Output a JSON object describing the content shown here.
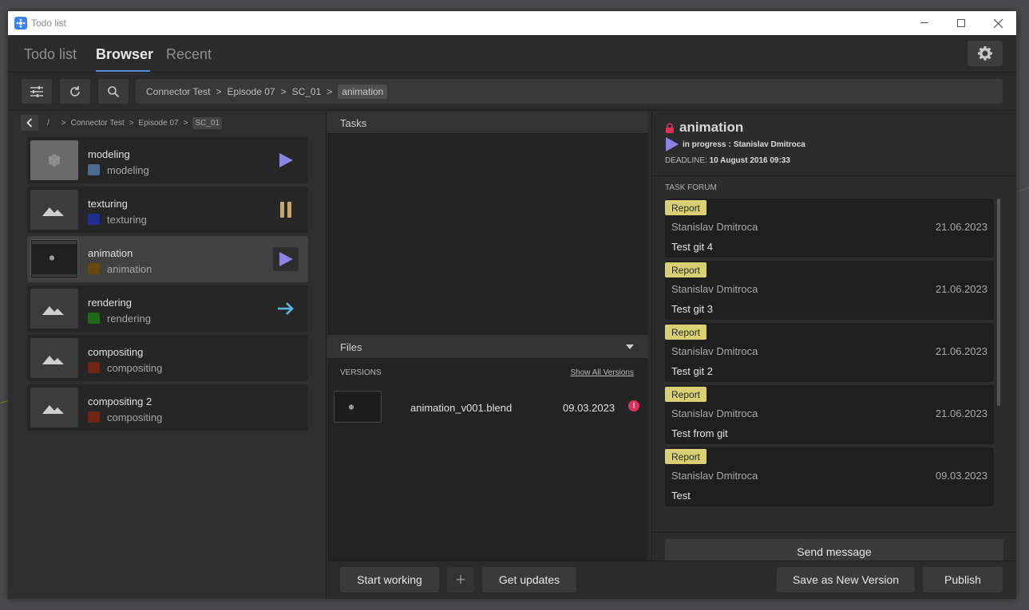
{
  "window": {
    "title": "Todo list"
  },
  "tabs": [
    {
      "label": "Todo list"
    },
    {
      "label": "Browser"
    },
    {
      "label": "Recent"
    }
  ],
  "toolbar": {
    "path": [
      "Connector Test",
      "Episode 07",
      "SC_01",
      "animation"
    ]
  },
  "breadcrumb": {
    "root": "/",
    "items": [
      "Connector Test",
      "Episode 07",
      "SC_01"
    ]
  },
  "tasks": [
    {
      "name": "modeling",
      "type": "modeling",
      "color": "#4d6a8f",
      "status": "play"
    },
    {
      "name": "texturing",
      "type": "texturing",
      "color": "#1f2f8f",
      "status": "pause"
    },
    {
      "name": "animation",
      "type": "animation",
      "color": "#6b4710",
      "status": "play"
    },
    {
      "name": "rendering",
      "type": "rendering",
      "color": "#1f6a16",
      "status": "arrow"
    },
    {
      "name": "compositing",
      "type": "compositing",
      "color": "#6e2412",
      "status": ""
    },
    {
      "name": "compositing 2",
      "type": "compositing",
      "color": "#6e2412",
      "status": ""
    }
  ],
  "middle": {
    "tasks_header": "Tasks",
    "files_header": "Files",
    "versions_label": "VERSIONS",
    "show_all": "Show All Versions",
    "versions": [
      {
        "filename": "animation_v001.blend",
        "date": "09.03.2023",
        "error": "!"
      }
    ]
  },
  "detail": {
    "title": "animation",
    "status_label": "in progress",
    "assignee": "Stanislav Dmitroca",
    "deadline_label": "DEADLINE:",
    "deadline": "10 August 2016 09:33",
    "forum_label": "TASK FORUM",
    "messages": [
      {
        "tag": "Report",
        "author": "Stanislav Dmitroca",
        "date": "21.06.2023",
        "text": "Test git 4"
      },
      {
        "tag": "Report",
        "author": "Stanislav Dmitroca",
        "date": "21.06.2023",
        "text": "Test git 3"
      },
      {
        "tag": "Report",
        "author": "Stanislav Dmitroca",
        "date": "21.06.2023",
        "text": "Test git 2"
      },
      {
        "tag": "Report",
        "author": "Stanislav Dmitroca",
        "date": "21.06.2023",
        "text": "Test from git"
      },
      {
        "tag": "Report",
        "author": "Stanislav Dmitroca",
        "date": "09.03.2023",
        "text": "Test"
      }
    ],
    "send_label": "Send message"
  },
  "bottom": {
    "start_working": "Start working",
    "add": "+",
    "get_updates": "Get updates",
    "save_new_version": "Save as New Version",
    "publish": "Publish"
  },
  "colors": {
    "accent": "#5b8fe0",
    "play": "#8b84e6",
    "pause": "#c9a46a",
    "arrow": "#5fb8e6",
    "lock": "#e0305a",
    "badge": "#d9cf73"
  }
}
